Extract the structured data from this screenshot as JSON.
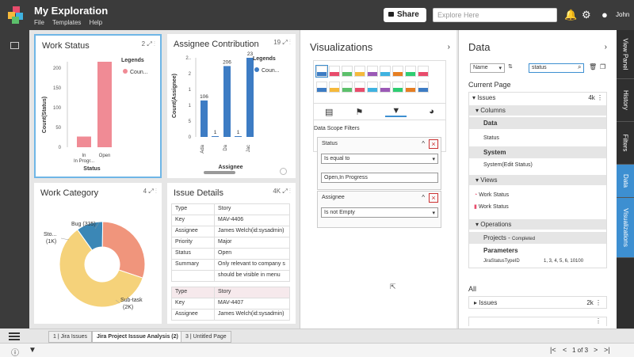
{
  "app": {
    "title": "My Exploration",
    "menu": [
      "File",
      "Templates",
      "Help"
    ],
    "share_label": "Share",
    "search_placeholder": "Explore Here",
    "user": "John"
  },
  "widgets": {
    "work_status": {
      "title": "Work Status",
      "count": "2",
      "legend_title": "Legends",
      "legend_item": "Coun...",
      "ylabel": "Count(Status)",
      "xlabel": "Status"
    },
    "assignee": {
      "title": "Assignee Contribution",
      "count": "19",
      "legend_title": "Legends",
      "legend_item": "Coun...",
      "ylabel": "Count(Assignee)",
      "xlabel": "Assignee"
    },
    "work_category": {
      "title": "Work Category",
      "count": "4",
      "labels": [
        "Bug (335)",
        "Sto...",
        "(1K)",
        "Sub-task",
        "(2K)"
      ]
    },
    "issue_details": {
      "title": "Issue Details",
      "count": "4K",
      "record1": [
        [
          "Type",
          "Story"
        ],
        [
          "Key",
          "MAV-4406"
        ],
        [
          "Assignee",
          "James Welch(id:sysadmin)"
        ],
        [
          "Priority",
          "Major"
        ],
        [
          "Status",
          "Open"
        ],
        [
          "Summary",
          "Only relevant to company s"
        ],
        [
          "",
          "should be visible in menu"
        ]
      ],
      "record2": [
        [
          "Type",
          "Story"
        ],
        [
          "Key",
          "MAV-4407"
        ],
        [
          "Assignee",
          "James Welch(id:sysadmin)"
        ]
      ]
    }
  },
  "chart_data": [
    {
      "type": "bar",
      "categories": [
        "In Progr...",
        "Open"
      ],
      "values": [
        27,
        216
      ],
      "ylabel": "Count(Status)",
      "xlabel": "Status",
      "yticks": [
        "0",
        "50",
        "100",
        "150",
        "200"
      ],
      "ylim": [
        0,
        216
      ],
      "color": "#f08b95"
    },
    {
      "type": "bar",
      "categories": [
        "Ada",
        "Da",
        "Jac"
      ],
      "values": [
        106,
        1,
        206,
        1,
        230
      ],
      "value_labels": [
        "106",
        "1",
        "206",
        "1",
        "23"
      ],
      "ylabel": "Count(Assignee)",
      "xlabel": "Assignee",
      "yticks": [
        "0",
        "5",
        "1",
        "1",
        "2",
        "2.."
      ],
      "ylim": [
        0,
        230
      ],
      "color": "#3d7cc4"
    },
    {
      "type": "pie",
      "slices": [
        {
          "label": "Bug (335)",
          "value": 335,
          "color": "#3b87b6"
        },
        {
          "label": "Sto... (1K)",
          "value": 1000,
          "color": "#f0957c"
        },
        {
          "label": "Sub-task (2K)",
          "value": 2000,
          "color": "#f5d27a"
        }
      ]
    }
  ],
  "visualizations": {
    "title": "Visualizations",
    "section": "Data Scope Filters",
    "filters": [
      {
        "name": "Status",
        "op": "Is equal to",
        "value": "Open,In Progress"
      },
      {
        "name": "Assignee",
        "op": "Is not Empty"
      }
    ]
  },
  "data_panel": {
    "title": "Data",
    "sort": "Name",
    "search_value": "status",
    "current_page": "Current Page",
    "issues": "Issues",
    "issues_count": "4k",
    "columns": "Columns",
    "data_label": "Data",
    "status": "Status",
    "system": "System",
    "system_item": "System(Edit Status)",
    "views": "Views",
    "view1": "Work Status",
    "view2": "Work Status",
    "operations": "Operations",
    "projects": "Projects -",
    "completed": "Completed",
    "parameters": "Parameters",
    "param_name": "JiraStatusTypeID",
    "param_value": "1, 3, 4, 5, 6, 10100",
    "all": "All",
    "all_issues": "Issues",
    "all_count": "2k"
  },
  "right_tabs": [
    "View Panel",
    "History",
    "Filters",
    "Data",
    "Visualizations"
  ],
  "pages": [
    "1 | Jira Issues",
    "Jira Project Isssue Analysis (2)",
    "3 | Untitled Page"
  ],
  "pager": "1 of 3"
}
